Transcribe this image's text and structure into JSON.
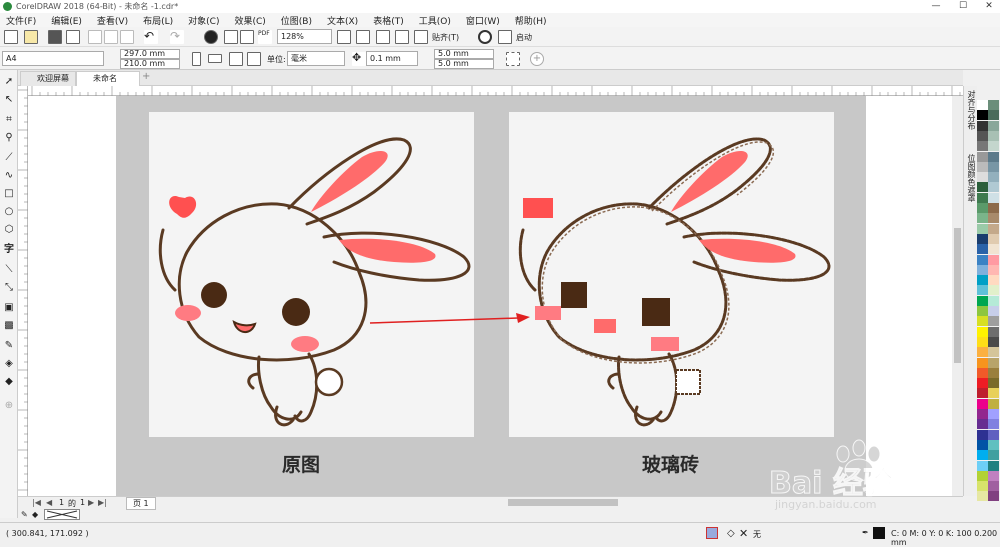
{
  "window": {
    "title": "CorelDRAW 2018 (64-Bit) - 未命名 -1.cdr*",
    "minimize": "—",
    "maximize": "☐",
    "close": "✕"
  },
  "menu": [
    "文件(F)",
    "编辑(E)",
    "查看(V)",
    "布局(L)",
    "对象(C)",
    "效果(C)",
    "位图(B)",
    "文本(X)",
    "表格(T)",
    "工具(O)",
    "窗口(W)",
    "帮助(H)"
  ],
  "toolbar1": {
    "zoom": "128%",
    "snap_label": "贴齐(T)",
    "launch_label": "启动"
  },
  "toolbar2": {
    "page_size": "A4",
    "width": "297.0 mm",
    "height": "210.0 mm",
    "units_label": "单位:",
    "units_value": "毫米",
    "nudge": "0.1 mm",
    "dup_x": "5.0 mm",
    "dup_y": "5.0 mm"
  },
  "doc_tabs": [
    {
      "label": "欢迎屏幕"
    },
    {
      "label": "未命名 -1.cdr*"
    }
  ],
  "canvas": {
    "left_caption": "原图",
    "right_caption": "玻璃砖"
  },
  "dockers": [
    "对齐与分布",
    "位图颜色遮罩"
  ],
  "pagebar": {
    "page_num": "1",
    "of": "的",
    "total": "1",
    "page_tab": "页 1"
  },
  "status": {
    "coords": "( 300.841, 171.092 )",
    "fill_none": "无",
    "color_info": "C: 0 M: 0 Y: 0 K: 100  0.200 mm"
  },
  "watermark": {
    "brand": "Bai 经验",
    "url": "jingyan.baidu.com"
  },
  "colors": {
    "accent_red": "#ff6b6b",
    "rabbit_stroke": "#5a3a22",
    "eye": "#4a2a14",
    "cheek": "#ff7b82",
    "arrow": "#e02020"
  }
}
